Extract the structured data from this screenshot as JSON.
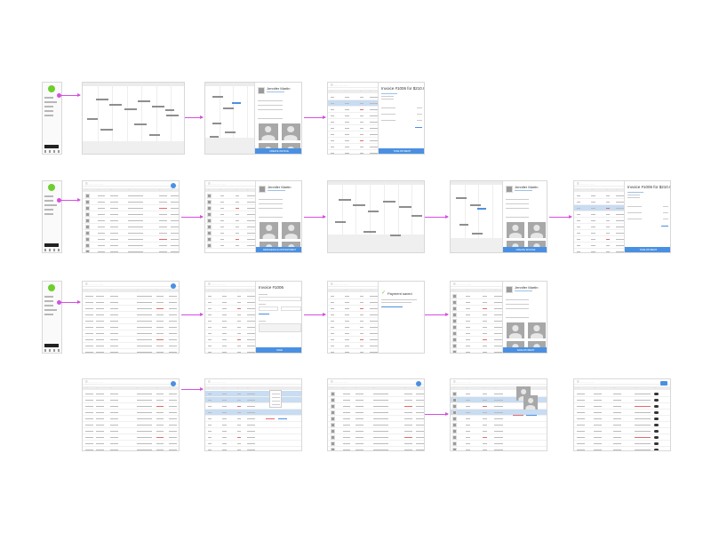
{
  "colors": {
    "accent": "#4a90e2",
    "flow": "#d64fe0",
    "brand": "#6fce2f"
  },
  "icons": {
    "logo": "green-circle",
    "add": "plus-circle-icon",
    "check": "checkmark-icon"
  },
  "labels": {
    "name": "Jennifer Martin",
    "invoice_amount": "Invoice #1006 for $210.00",
    "invoice_short": "Invoice #1006",
    "payment_saved": "Payment saved",
    "btn_create_invoice": "CREATE INVOICE",
    "btn_take_payment": "TAKE PAYMENT",
    "btn_reschedule": "RESCHEDULE APPOINTMENT",
    "btn_save": "SAVE",
    "btn_save_payment": "SAVE PAYMENT"
  }
}
